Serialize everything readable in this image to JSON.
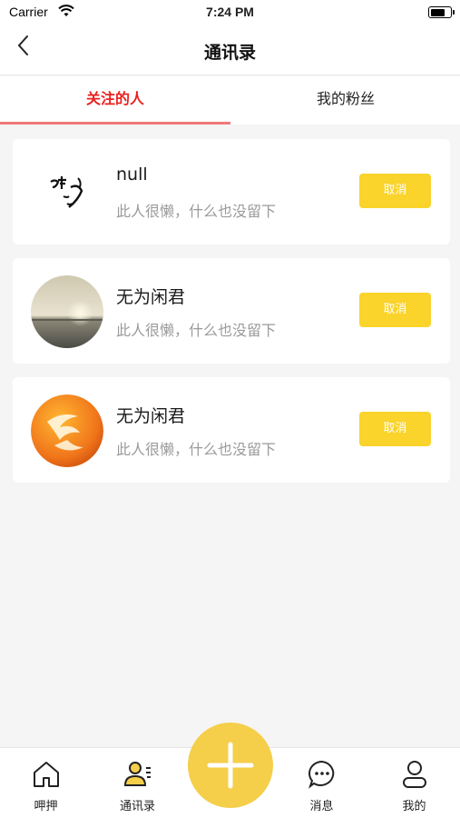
{
  "status_bar": {
    "carrier": "Carrier",
    "time": "7:24 PM"
  },
  "nav": {
    "title": "通讯录"
  },
  "tabs": [
    {
      "label": "关注的人",
      "active": true
    },
    {
      "label": "我的粉丝",
      "active": false
    }
  ],
  "contacts": [
    {
      "name": "null",
      "bio": "此人很懒，什么也没留下",
      "action": "取消",
      "avatar": "calligraphy-avatar"
    },
    {
      "name": "无为闲君",
      "bio": "此人很懒，什么也没留下",
      "action": "取消",
      "avatar": "sunset-sea-avatar"
    },
    {
      "name": "无为闲君",
      "bio": "此人很懒，什么也没留下",
      "action": "取消",
      "avatar": "orange-logo-avatar"
    }
  ],
  "tabbar": [
    {
      "label": "呷押",
      "icon": "home-icon"
    },
    {
      "label": "通讯录",
      "icon": "contacts-icon"
    },
    {
      "label": "",
      "icon": "plus-icon"
    },
    {
      "label": "消息",
      "icon": "message-icon"
    },
    {
      "label": "我的",
      "icon": "profile-icon"
    }
  ],
  "colors": {
    "accent_yellow": "#fad32b",
    "active_tab_red": "#e8211f",
    "underline": "#f07878"
  }
}
